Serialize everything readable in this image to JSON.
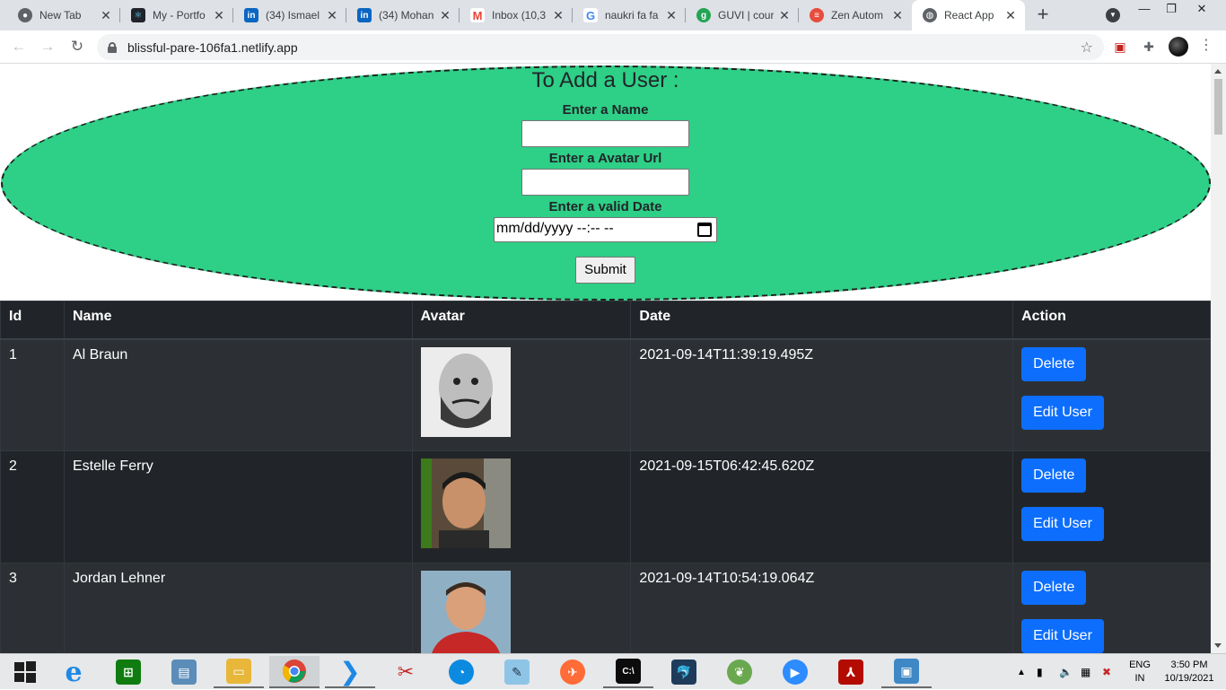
{
  "browser": {
    "tabs": [
      {
        "label": "New Tab",
        "favicon": "chrome-icon",
        "color": "#5f6368"
      },
      {
        "label": "My - Portfo",
        "favicon": "react-icon",
        "color": "#20232a"
      },
      {
        "label": "(34) Ismael",
        "favicon": "linkedin-icon",
        "color": "#0a66c2"
      },
      {
        "label": "(34) Mohan",
        "favicon": "linkedin-icon",
        "color": "#0a66c2"
      },
      {
        "label": "Inbox (10,3",
        "favicon": "gmail-icon",
        "color": "#ea4335"
      },
      {
        "label": "naukri fa fa",
        "favicon": "google-icon",
        "color": "#4285f4"
      },
      {
        "label": "GUVI | cour",
        "favicon": "guvi-icon",
        "color": "#23a455"
      },
      {
        "label": "Zen Autom",
        "favicon": "zen-icon",
        "color": "#e74c3c"
      },
      {
        "label": "React App",
        "favicon": "globe-icon",
        "color": "#5f6368",
        "active": true
      }
    ],
    "url": "blissful-pare-106fa1.netlify.app"
  },
  "form": {
    "title": "To Add a User :",
    "name_label": "Enter a Name",
    "avatar_label": "Enter a Avatar Url",
    "date_label": "Enter a valid Date",
    "date_placeholder": "mm/dd/yyyy --:-- --",
    "submit_label": "Submit"
  },
  "table": {
    "headers": [
      "Id",
      "Name",
      "Avatar",
      "Date",
      "Action"
    ],
    "rows": [
      {
        "id": "1",
        "name": "Al Braun",
        "date": "2021-09-14T11:39:19.495Z"
      },
      {
        "id": "2",
        "name": "Estelle Ferry",
        "date": "2021-09-15T06:42:45.620Z"
      },
      {
        "id": "3",
        "name": "Jordan Lehner",
        "date": "2021-09-14T10:54:19.064Z"
      }
    ],
    "delete_label": "Delete",
    "edit_label": "Edit User"
  },
  "taskbar": {
    "lang": [
      "ENG",
      "IN"
    ],
    "time": "3:50 PM",
    "date": "10/19/2021"
  },
  "colors": {
    "accent_green": "#2ecf86",
    "button_blue": "#0d6efd",
    "table_dark": "#212529"
  }
}
